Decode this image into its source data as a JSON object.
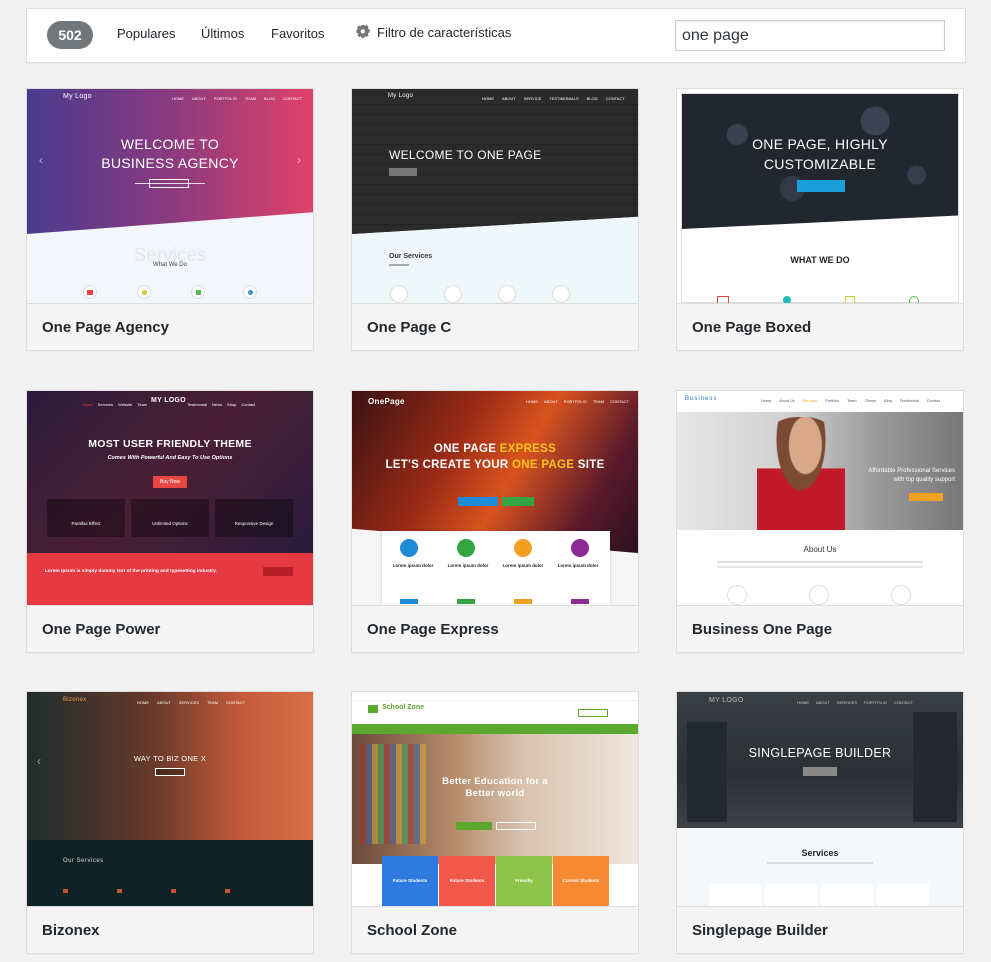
{
  "filter_bar": {
    "count": "502",
    "links": [
      "Populares",
      "Últimos",
      "Favoritos"
    ],
    "feature_filter": "Filtro de características",
    "search_value": "one page"
  },
  "themes": [
    {
      "name": "One Page Agency",
      "logo": "My Logo",
      "hero": [
        "WELCOME TO",
        "BUSINESS AGENCY"
      ],
      "section_watermark": "Services",
      "section_title": "What We Do"
    },
    {
      "name": "One Page C",
      "logo": "My Logo",
      "hero": [
        "WELCOME TO ONE PAGE"
      ],
      "section_title": "Our Services"
    },
    {
      "name": "One Page Boxed",
      "hero": [
        "ONE PAGE, HIGHLY",
        "CUSTOMIZABLE"
      ],
      "section_title": "WHAT WE DO"
    },
    {
      "name": "One Page Power",
      "logo": "MY LOGO",
      "hero": [
        "MOST USER FRIENDLY THEME"
      ],
      "subtitle": "Comes With Powerful And Easy To Use Options",
      "button": "Buy Now",
      "features": [
        "Parallax Effect",
        "Unlimited Options",
        "Responsive Design"
      ],
      "bar_text": "Lorem Ipsum is simply dummy text of the printing and typesetting industry."
    },
    {
      "name": "One Page Express",
      "logo": "OnePage",
      "hero_line1": [
        "ONE PAGE ",
        "EXPRESS"
      ],
      "hero_line2": [
        "LET'S CREATE YOUR ",
        "ONE PAGE",
        " SITE"
      ],
      "card_title": "Lorem ipsum dolor"
    },
    {
      "name": "Business One Page",
      "logo": "Business",
      "hero_text": [
        "Affordable Professional Services",
        "with top quality support"
      ],
      "section_title": "About Us"
    },
    {
      "name": "Bizonex",
      "logo": "Bizonex",
      "hero": [
        "WAY TO BIZ ONE X"
      ],
      "section_title": "Our Services"
    },
    {
      "name": "School Zone",
      "logo": "School Zone",
      "hero": [
        "Better Education for a",
        "Better world"
      ],
      "tiles": [
        "Future Students",
        "Future Students",
        "Friendly",
        "Current Students"
      ]
    },
    {
      "name": "Singlepage Builder",
      "logo": "MY LOGO",
      "hero": [
        "SINGLEPAGE BUILDER"
      ],
      "section_title": "Services"
    }
  ]
}
